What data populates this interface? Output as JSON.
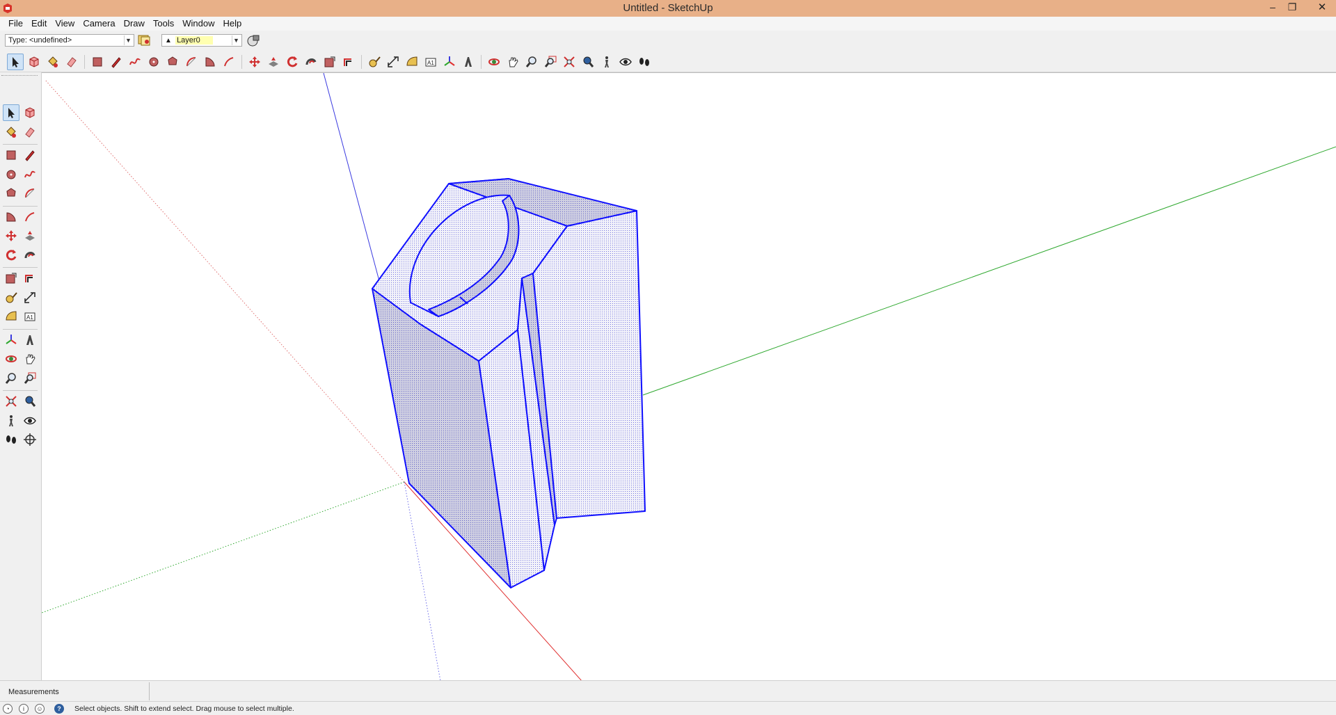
{
  "window": {
    "title": "Untitled - SketchUp",
    "minimize_glyph": "–",
    "maximize_glyph": "❐",
    "close_glyph": "✕"
  },
  "menu": [
    "File",
    "Edit",
    "View",
    "Camera",
    "Draw",
    "Tools",
    "Window",
    "Help"
  ],
  "entity_info": {
    "type_value": "Type: <undefined>",
    "layer_value": "Layer0"
  },
  "main_toolbar": {
    "tools": [
      {
        "name": "select-tool",
        "icon": "arrow-icon",
        "active": true
      },
      {
        "name": "make-component-tool",
        "icon": "component-icon"
      },
      {
        "name": "paint-bucket-tool",
        "icon": "paint-bucket-icon"
      },
      {
        "name": "eraser-tool",
        "icon": "eraser-icon"
      },
      {
        "name": "rectangle-tool",
        "icon": "rectangle-icon"
      },
      {
        "name": "line-tool",
        "icon": "pencil-icon"
      },
      {
        "name": "freehand-tool",
        "icon": "freehand-icon"
      },
      {
        "name": "circle-tool",
        "icon": "circle-icon"
      },
      {
        "name": "polygon-tool",
        "icon": "polygon-icon"
      },
      {
        "name": "arc-tool",
        "icon": "arc-icon"
      },
      {
        "name": "pie-tool",
        "icon": "pie-icon"
      },
      {
        "name": "two-point-arc-tool",
        "icon": "arc2-icon"
      },
      {
        "name": "move-tool",
        "icon": "move-icon"
      },
      {
        "name": "push-pull-tool",
        "icon": "pushpull-icon"
      },
      {
        "name": "rotate-tool",
        "icon": "rotate-icon"
      },
      {
        "name": "follow-me-tool",
        "icon": "followme-icon"
      },
      {
        "name": "scale-tool",
        "icon": "scale-icon"
      },
      {
        "name": "offset-tool",
        "icon": "offset-icon"
      },
      {
        "name": "tape-measure-tool",
        "icon": "tape-icon"
      },
      {
        "name": "dimension-tool",
        "icon": "dimension-icon"
      },
      {
        "name": "protractor-tool",
        "icon": "protractor-icon"
      },
      {
        "name": "text-tool",
        "icon": "text-icon"
      },
      {
        "name": "axes-tool",
        "icon": "axes-icon"
      },
      {
        "name": "3d-text-tool",
        "icon": "3dtext-icon"
      },
      {
        "name": "orbit-tool",
        "icon": "orbit-icon"
      },
      {
        "name": "pan-tool",
        "icon": "pan-icon"
      },
      {
        "name": "zoom-tool",
        "icon": "zoom-icon"
      },
      {
        "name": "zoom-window-tool",
        "icon": "zoom-window-icon"
      },
      {
        "name": "zoom-extents-tool",
        "icon": "zoom-extents-icon"
      },
      {
        "name": "previous-view-tool",
        "icon": "previous-icon"
      },
      {
        "name": "position-camera-tool",
        "icon": "camera-icon"
      },
      {
        "name": "look-around-tool",
        "icon": "eye-icon"
      },
      {
        "name": "walk-tool",
        "icon": "footprints-icon"
      }
    ]
  },
  "left_toolbar": {
    "tools": [
      {
        "name": "select-tool",
        "icon": "arrow-icon",
        "active": true
      },
      {
        "name": "make-component-tool",
        "icon": "component-icon"
      },
      {
        "name": "paint-bucket-tool",
        "icon": "paint-bucket-icon"
      },
      {
        "name": "eraser-tool",
        "icon": "eraser-icon"
      },
      {
        "name": "rectangle-tool",
        "icon": "rectangle-icon"
      },
      {
        "name": "line-tool",
        "icon": "pencil-icon"
      },
      {
        "name": "circle-tool",
        "icon": "circle-icon"
      },
      {
        "name": "freehand-tool",
        "icon": "freehand-icon"
      },
      {
        "name": "polygon-tool",
        "icon": "polygon-icon"
      },
      {
        "name": "arc-tool",
        "icon": "arc-icon"
      },
      {
        "name": "pie-tool",
        "icon": "pie-icon"
      },
      {
        "name": "two-point-arc-tool",
        "icon": "arc2-icon"
      },
      {
        "name": "move-tool",
        "icon": "move-icon"
      },
      {
        "name": "push-pull-tool",
        "icon": "pushpull-icon"
      },
      {
        "name": "rotate-tool",
        "icon": "rotate-icon"
      },
      {
        "name": "follow-me-tool",
        "icon": "followme-icon"
      },
      {
        "name": "scale-tool",
        "icon": "scale-icon"
      },
      {
        "name": "offset-tool",
        "icon": "offset-icon"
      },
      {
        "name": "tape-measure-tool",
        "icon": "tape-icon"
      },
      {
        "name": "dimension-tool",
        "icon": "dimension-icon"
      },
      {
        "name": "protractor-tool",
        "icon": "protractor-icon"
      },
      {
        "name": "text-tool",
        "icon": "text-icon"
      },
      {
        "name": "axes-tool",
        "icon": "axes-icon"
      },
      {
        "name": "3d-text-tool",
        "icon": "3dtext-icon"
      },
      {
        "name": "orbit-tool",
        "icon": "orbit-icon"
      },
      {
        "name": "pan-tool",
        "icon": "pan-icon"
      },
      {
        "name": "zoom-tool",
        "icon": "zoom-icon"
      },
      {
        "name": "zoom-window-tool",
        "icon": "zoom-window-icon"
      },
      {
        "name": "zoom-extents-tool",
        "icon": "zoom-extents-icon"
      },
      {
        "name": "previous-view-tool",
        "icon": "previous-icon"
      },
      {
        "name": "position-camera-tool",
        "icon": "camera-icon"
      },
      {
        "name": "look-around-tool",
        "icon": "eye-icon"
      },
      {
        "name": "walk-tool",
        "icon": "footprints-icon"
      },
      {
        "name": "section-plane-tool",
        "icon": "section-icon"
      }
    ]
  },
  "measurements": {
    "label": "Measurements"
  },
  "status": {
    "message": "Select objects. Shift to extend select. Drag mouse to select multiple.",
    "help_glyph": "?",
    "geo_glyph": "◔",
    "info_glyph": "i",
    "user_glyph": "☺"
  },
  "colors": {
    "title_bar": "#e8b088",
    "axis_red": "#e03030",
    "axis_green": "#2ea82e",
    "axis_blue": "#3a3ae0",
    "selection": "#1010ff",
    "face_fill": "#eeeef8",
    "face_shade": "#c8c8dc"
  }
}
